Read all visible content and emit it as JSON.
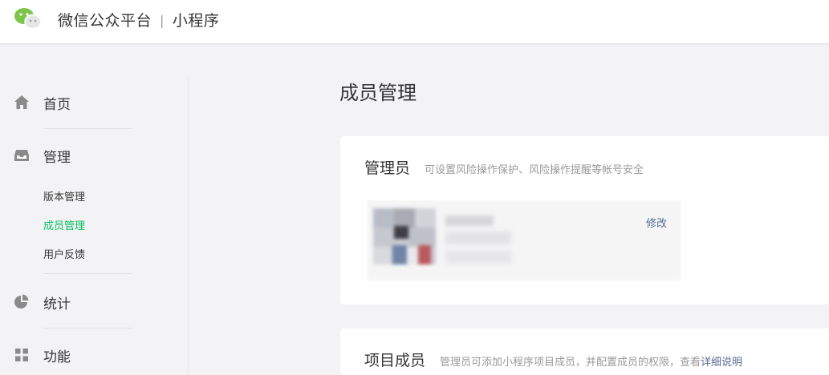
{
  "header": {
    "platform": "微信公众平台",
    "separator": "|",
    "product": "小程序",
    "icon": "wechat-logo"
  },
  "sidebar": {
    "items": [
      {
        "label": "首页",
        "icon": "home-icon"
      },
      {
        "label": "管理",
        "icon": "inbox-icon",
        "children": [
          {
            "label": "版本管理",
            "active": false
          },
          {
            "label": "成员管理",
            "active": true
          },
          {
            "label": "用户反馈",
            "active": false
          }
        ]
      },
      {
        "label": "统计",
        "icon": "pie-chart-icon"
      },
      {
        "label": "功能",
        "icon": "grid-icon"
      }
    ]
  },
  "main": {
    "title": "成员管理",
    "admin_card": {
      "title": "管理员",
      "desc": "可设置风险操作保护、风险操作提醒等帐号安全",
      "edit": "修改"
    },
    "members_card": {
      "title": "项目成员",
      "desc": "管理员可添加小程序项目成员，并配置成员的权限，查看",
      "link": "详细说明"
    }
  },
  "colors": {
    "accent_green": "#07c160",
    "link_blue": "#576b95",
    "background": "#f3f3f5"
  }
}
